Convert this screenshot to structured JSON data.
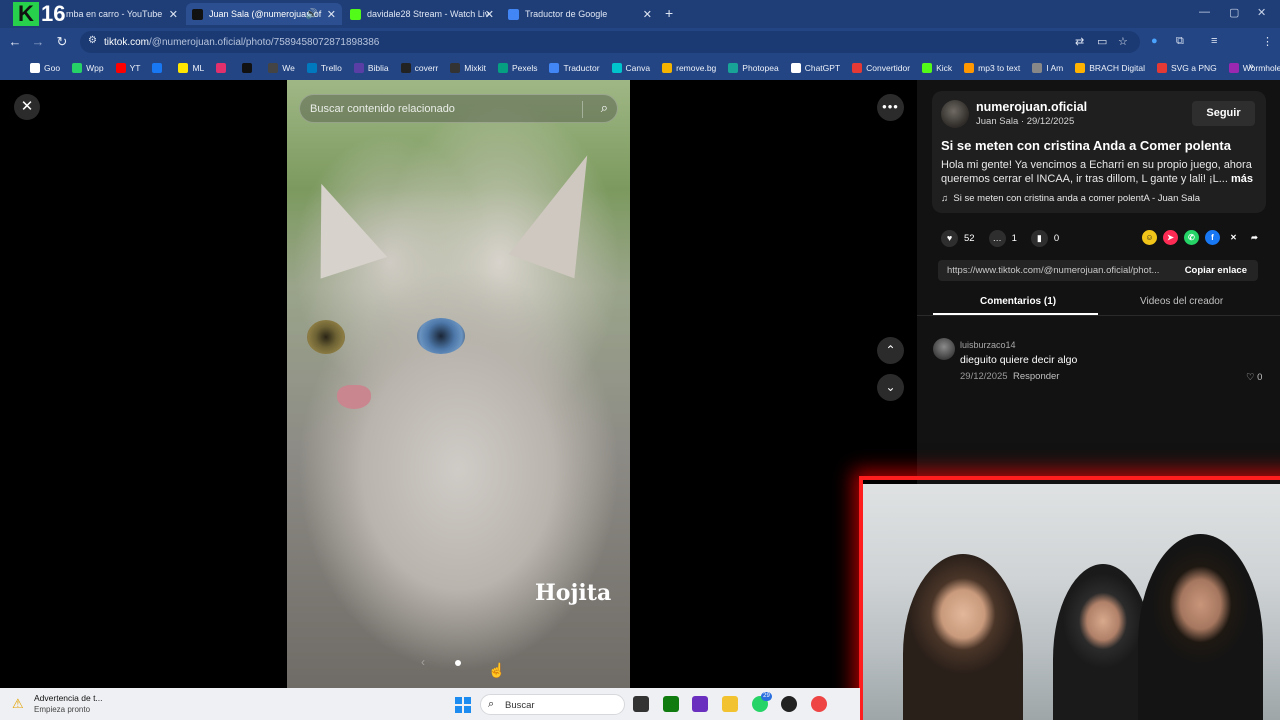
{
  "browser": {
    "tabs": [
      {
        "label": "mba en carro - YouTube",
        "active": false
      },
      {
        "label": "Juan Sala (@numerojuan.of",
        "active": true
      },
      {
        "label": "davidale28 Stream - Watch Liv",
        "active": false
      },
      {
        "label": "Traductor de Google",
        "active": false
      }
    ],
    "logo_k": "K",
    "logo_num": "16",
    "url_host": "tiktok.com",
    "url_path": "/@numerojuan.oficial/photo/7589458072871898386",
    "profile_initial": "D",
    "bookmarks": [
      {
        "label": "Goo",
        "color": "#ffffff"
      },
      {
        "label": "Wpp",
        "color": "#25d366"
      },
      {
        "label": "YT",
        "color": "#ff0000"
      },
      {
        "label": "",
        "color": "#1877f2"
      },
      {
        "label": "ML",
        "color": "#ffe600"
      },
      {
        "label": "",
        "color": "#e1306c"
      },
      {
        "label": "",
        "color": "#111111"
      },
      {
        "label": "We",
        "color": "#444444"
      },
      {
        "label": "Trello",
        "color": "#0079bf"
      },
      {
        "label": "Biblia",
        "color": "#5a3ea5"
      },
      {
        "label": "coverr",
        "color": "#222222"
      },
      {
        "label": "Mixkit",
        "color": "#333333"
      },
      {
        "label": "Pexels",
        "color": "#05a081"
      },
      {
        "label": "Traductor",
        "color": "#4285f4"
      },
      {
        "label": "Canva",
        "color": "#00c4cc"
      },
      {
        "label": "remove.bg",
        "color": "#f4b400"
      },
      {
        "label": "Photopea",
        "color": "#18a497"
      },
      {
        "label": "ChatGPT",
        "color": "#ffffff"
      },
      {
        "label": "Convertidor",
        "color": "#e53935"
      },
      {
        "label": "Kick",
        "color": "#53fc18"
      },
      {
        "label": "mp3 to text",
        "color": "#ff9800"
      },
      {
        "label": "I Am",
        "color": "#888888"
      },
      {
        "label": "BRACH Digital",
        "color": "#ffb300"
      },
      {
        "label": "SVG a PNG",
        "color": "#e53935"
      },
      {
        "label": "Wormhole",
        "color": "#9c27b0"
      }
    ]
  },
  "viewer": {
    "search_placeholder": "Buscar contenido relacionado",
    "photo_caption": "Hojita"
  },
  "post": {
    "username": "numerojuan.oficial",
    "display_name_date": "Juan Sala · 29/12/2025",
    "follow_label": "Seguir",
    "title": "Si se meten con cristina Anda a Comer polenta",
    "description": "Hola mi gente! Ya vencimos a Echarri en su propio juego, ahora queremos cerrar el INCAA, ir tras dillom, L gante y lali! ¡L...",
    "more_label": "más",
    "music": "Si se meten con cristina anda a comer polentA - Juan Sala",
    "likes": "52",
    "comments": "1",
    "saves": "0",
    "link": "https://www.tiktok.com/@numerojuan.oficial/phot...",
    "copy_label": "Copiar enlace",
    "tabs": [
      "Comentarios (1)",
      "Videos del creador"
    ]
  },
  "comment": {
    "user": "luisburzaco14",
    "text": "dieguito quiere decir algo",
    "date": "29/12/2025",
    "reply_label": "Responder",
    "likes": "0"
  },
  "taskbar": {
    "warning_title": "Advertencia de t...",
    "warning_sub": "Empieza pronto",
    "search_label": "Buscar",
    "badge": "29"
  }
}
